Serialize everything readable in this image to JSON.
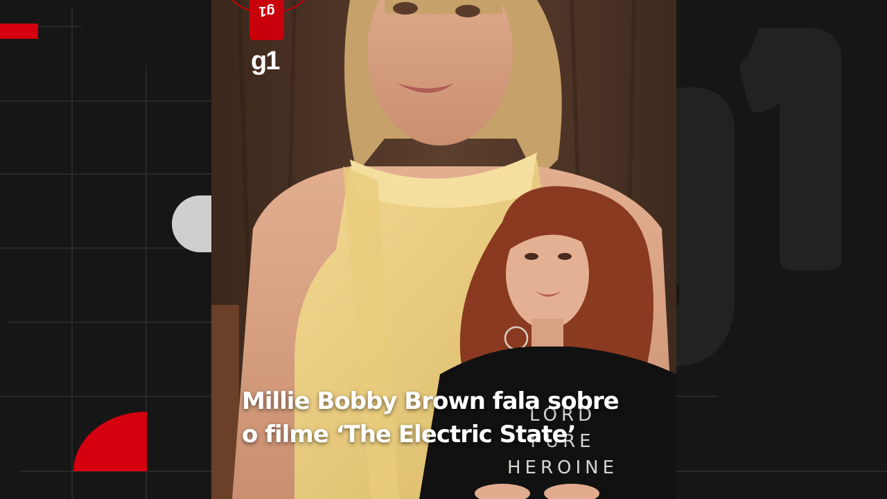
{
  "brand": {
    "name": "g1",
    "badge_label": "g1",
    "accent_color": "#d4000f"
  },
  "video": {
    "caption_line1": "Millie Bobby Brown fala sobre",
    "caption_line2": "o filme ‘The Electric State’",
    "shirt_lines": [
      "LORD",
      "PURE",
      "HEROINE"
    ]
  },
  "background": {
    "watermark_text": "g1"
  }
}
